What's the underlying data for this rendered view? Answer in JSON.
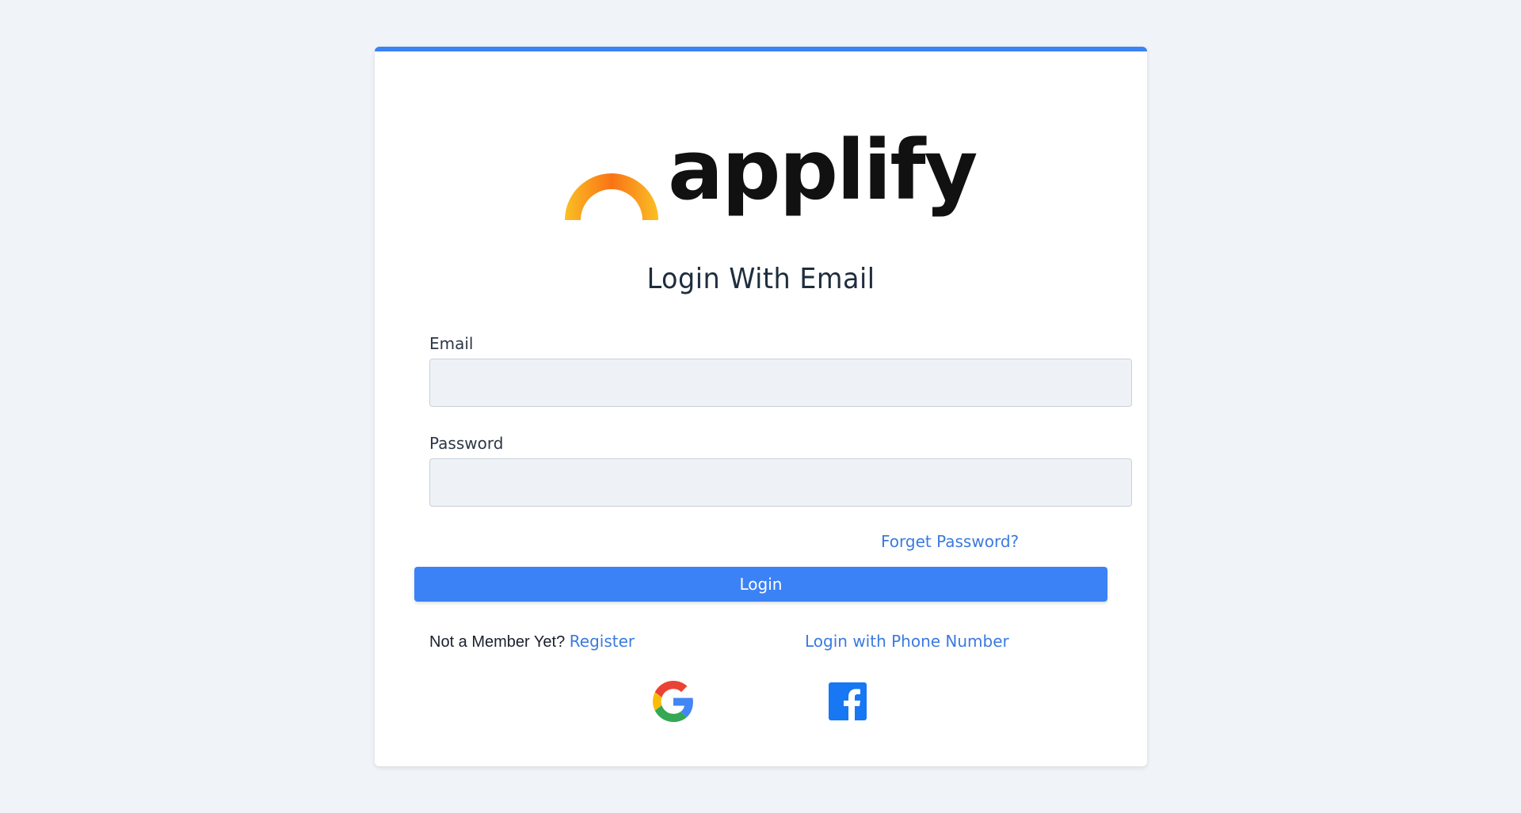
{
  "brand": {
    "name": "applify",
    "arc_colors": [
      "#f59e0b",
      "#f97316"
    ]
  },
  "form": {
    "title": "Login With Email",
    "email_label": "Email",
    "email_value": "",
    "password_label": "Password",
    "password_value": "",
    "forget_password": "Forget Password?",
    "login_button": "Login"
  },
  "footer": {
    "not_member_text": "Not a Member Yet?",
    "register_link": "Register",
    "phone_login_link": "Login with Phone Number"
  },
  "social": {
    "google_icon": "google-icon",
    "facebook_icon": "facebook-icon"
  },
  "colors": {
    "accent": "#3b82f6",
    "link": "#3b7ae0",
    "background": "#f0f3f8"
  }
}
